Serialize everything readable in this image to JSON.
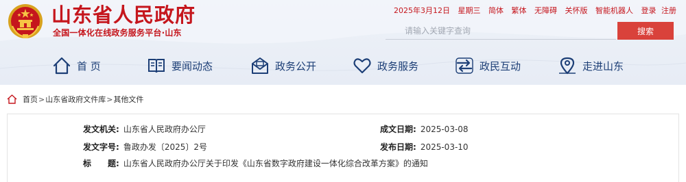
{
  "header": {
    "site_title": "山东省人民政府",
    "site_subtitle": "全国一体化在线政务服务平台·山东",
    "topbar": {
      "date": "2025年3月12日",
      "weekday": "星期三",
      "simplified": "简体",
      "traditional": "繁体",
      "accessibility": "无障碍",
      "elderly": "关怀版",
      "robot": "智能机器人",
      "login": "登录",
      "register": "注册"
    },
    "search": {
      "placeholder": "请输入关键字查询",
      "button_label": "搜索"
    }
  },
  "nav": {
    "items": [
      {
        "label": "首 页",
        "icon": "home-icon"
      },
      {
        "label": "要闻动态",
        "icon": "book-icon"
      },
      {
        "label": "政务公开",
        "icon": "mail-icon"
      },
      {
        "label": "政务服务",
        "icon": "heart-icon"
      },
      {
        "label": "政民互动",
        "icon": "exchange-icon"
      },
      {
        "label": "走进山东",
        "icon": "map-pin-icon"
      }
    ]
  },
  "breadcrumb": {
    "home": "首页",
    "library": "山东省政府文件库",
    "current": "其他文件",
    "separator": ">"
  },
  "document": {
    "issuer_label": "发文机关:",
    "issuer": "山东省人民政府办公厅",
    "date_written_label": "成文日期:",
    "date_written": "2025-03-08",
    "doc_number_label": "发文字号:",
    "doc_number": "鲁政办发〔2025〕2号",
    "published_label": "发布日期:",
    "published": "2025-03-10",
    "title_label": "标　　题:",
    "title": "山东省人民政府办公厅关于印发《山东省数字政府建设一体化综合改革方案》的通知"
  },
  "colors": {
    "brand_red": "#c5161d",
    "nav_blue": "#1c3e76",
    "search_button": "#d9423b"
  }
}
